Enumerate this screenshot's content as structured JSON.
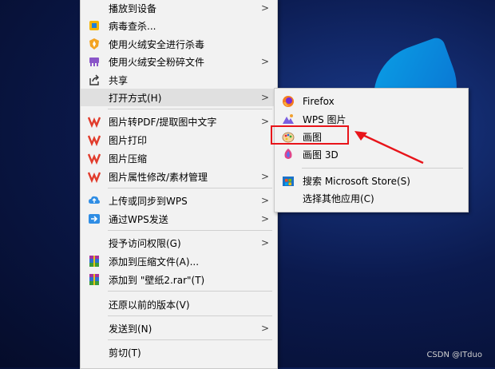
{
  "main_menu": {
    "items": [
      {
        "label": "播放到设备",
        "icon": "cast-icon",
        "submenu": true
      },
      {
        "label": "病毒查杀...",
        "icon": "virus-scan-icon",
        "submenu": false
      },
      {
        "label": "使用火绒安全进行杀毒",
        "icon": "huorong-shield-icon",
        "submenu": false
      },
      {
        "label": "使用火绒安全粉碎文件",
        "icon": "shredder-icon",
        "submenu": true
      },
      {
        "label": "共享",
        "icon": "share-icon",
        "submenu": false
      },
      {
        "label": "打开方式(H)",
        "icon": "",
        "submenu": true
      },
      {
        "label": "图片转PDF/提取图中文字",
        "icon": "wps-icon",
        "submenu": true
      },
      {
        "label": "图片打印",
        "icon": "wps-icon",
        "submenu": false
      },
      {
        "label": "图片压缩",
        "icon": "wps-icon",
        "submenu": false
      },
      {
        "label": "图片属性修改/素材管理",
        "icon": "wps-icon",
        "submenu": true
      },
      {
        "label": "上传或同步到WPS",
        "icon": "cloud-upload-icon",
        "submenu": true
      },
      {
        "label": "通过WPS发送",
        "icon": "send-arrow-icon",
        "submenu": true
      },
      {
        "label": "授予访问权限(G)",
        "icon": "",
        "submenu": true
      },
      {
        "label": "添加到压缩文件(A)...",
        "icon": "winrar-icon",
        "submenu": false
      },
      {
        "label": "添加到 \"壁纸2.rar\"(T)",
        "icon": "winrar-icon",
        "submenu": false
      },
      {
        "label": "还原以前的版本(V)",
        "icon": "",
        "submenu": false
      },
      {
        "label": "发送到(N)",
        "icon": "",
        "submenu": true
      },
      {
        "label": "剪切(T)",
        "icon": "",
        "submenu": false
      }
    ]
  },
  "sub_menu": {
    "items": [
      {
        "label": "Firefox",
        "icon": "firefox-icon"
      },
      {
        "label": "WPS 图片",
        "icon": "wps-photo-icon"
      },
      {
        "label": "画图",
        "icon": "paint-palette-icon"
      },
      {
        "label": "画图 3D",
        "icon": "paint3d-icon"
      },
      {
        "label": "搜索 Microsoft Store(S)",
        "icon": "store-icon"
      },
      {
        "label": "选择其他应用(C)",
        "icon": ""
      }
    ]
  },
  "watermark": "CSDN @ITduo",
  "colors": {
    "highlight": "#e8141a",
    "menu_bg": "#f2f2f2"
  }
}
